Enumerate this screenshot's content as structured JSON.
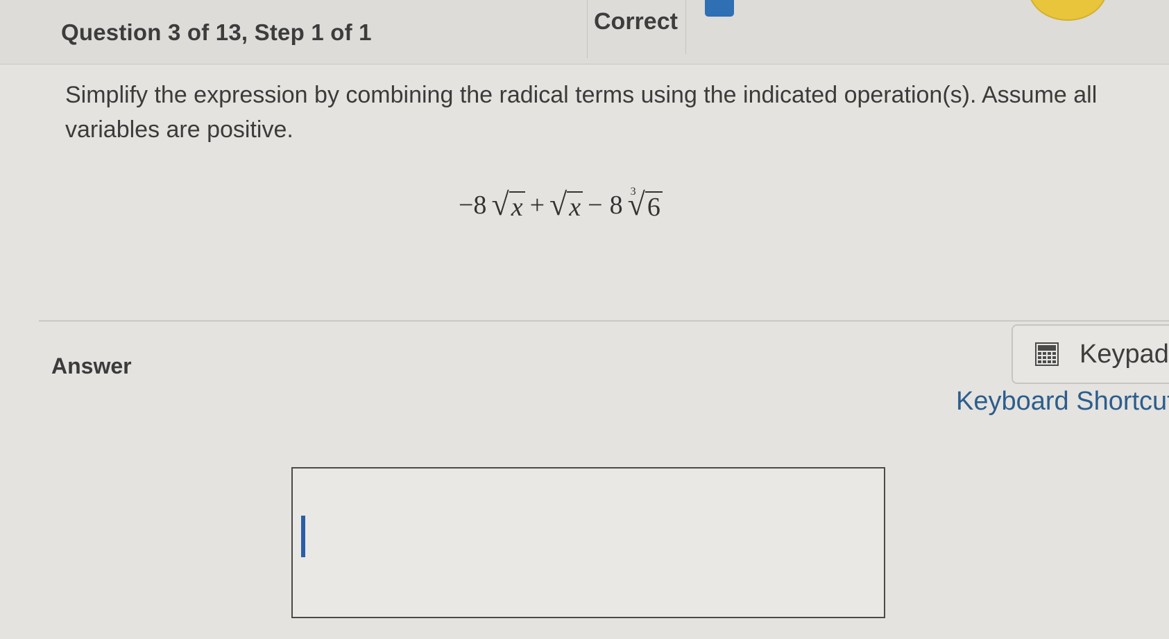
{
  "header": {
    "question_progress": "Question 3 of 13, Step 1 of 1",
    "status": "Correct"
  },
  "question": {
    "instructions": "Simplify the expression by combining the radical terms using the indicated operation(s). Assume all variables are positive.",
    "expression": {
      "term1_coef": "−8",
      "term1_radicand": "x",
      "op1": "+",
      "term2_radicand": "x",
      "op2": "−",
      "term3_coef": "8",
      "term3_index": "3",
      "term3_radicand": "6"
    }
  },
  "answer": {
    "label": "Answer",
    "value": ""
  },
  "tools": {
    "keypad_label": "Keypad",
    "shortcuts_label": "Keyboard Shortcuts",
    "keypad_icon": "calculator-icon"
  },
  "colors": {
    "accent": "#2f6fb4",
    "link": "#2d5d8c",
    "avatar": "#e8c53a"
  }
}
